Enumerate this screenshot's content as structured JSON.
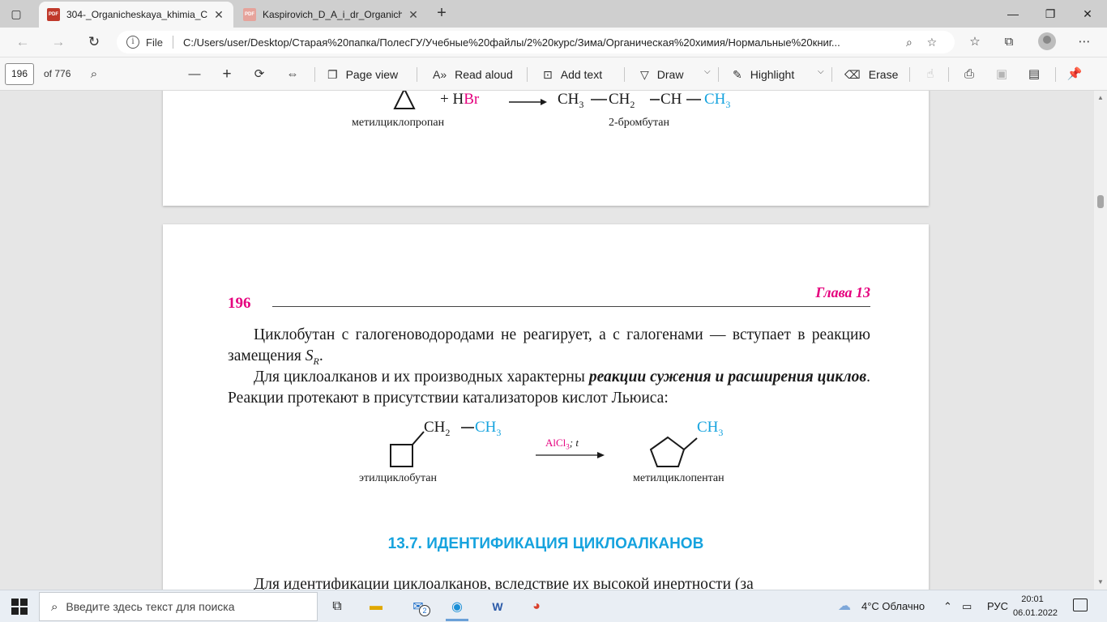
{
  "browser": {
    "tabs": [
      {
        "title": "304-_Organicheskaya_khimia_Ch",
        "active": true,
        "icon": "pdf-icon"
      },
      {
        "title": "Kaspirovich_D_A_i_dr_Organiche",
        "active": false,
        "icon": "pdf-icon"
      }
    ],
    "address": {
      "scheme_label": "File",
      "url": "C:/Users/user/Desktop/Старая%20папка/ПолесГУ/Учебные%20файлы/2%20курс/Зима/Органическая%20химия/Нормальные%20книг..."
    }
  },
  "pdf_toolbar": {
    "page_number": "196",
    "page_count": "of 776",
    "page_view": "Page view",
    "read_aloud": "Read aloud",
    "add_text": "Add text",
    "draw": "Draw",
    "highlight": "Highlight",
    "erase": "Erase"
  },
  "prev_page": {
    "reaction_plus": "+ H",
    "reaction_br": "Br",
    "product_ch3_a": "CH",
    "product_ch2": "CH",
    "product_ch": "CH",
    "product_ch3_b": "CH",
    "sub3": "3",
    "sub2": "2",
    "reactant_name": "метилциклопропан",
    "product_name": "2-бромбутан"
  },
  "page": {
    "number": "196",
    "chapter": "Глава 13",
    "para1_a": "Циклобутан с галогеноводородами не реагирует, а с галогенами — вступает в реакцию замещения ",
    "para1_s": "S",
    "para1_sub": "R",
    "para1_end": ".",
    "para2_a": "Для циклоалканов и их производных характерны ",
    "para2_em": "реакции сужения и расширения циклов",
    "para2_b": ". Реакции протекают в присутствии катализаторов кислот Льюиса:",
    "scheme": {
      "ch2": "CH",
      "ch3": "CH",
      "sub2": "2",
      "sub3": "3",
      "catalyst": "AlCl",
      "catalyst_sub": "3",
      "catalyst_t": "; t",
      "reactant_name": "этилциклобутан",
      "product_ch3": "CH",
      "product_name": "метилциклопентан"
    },
    "section_title": "13.7. ИДЕНТИФИКАЦИЯ ЦИКЛОАЛКАНОВ",
    "para3": "Для идентификации циклоалканов, вследствие их высокой инертности (за"
  },
  "taskbar": {
    "search_placeholder": "Введите здесь текст для поиска",
    "mail_badge": "2",
    "weather": "4°C  Облачно",
    "lang": "РУС",
    "time": "20:01",
    "date": "06.01.2022"
  },
  "colors": {
    "magenta": "#e5007e",
    "cyan": "#16a3de"
  }
}
